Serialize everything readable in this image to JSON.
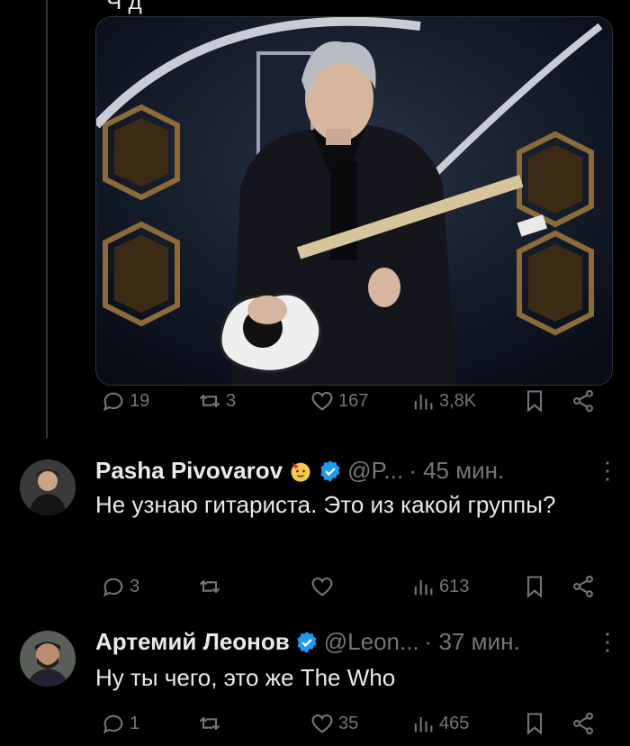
{
  "top_text": "Ч д",
  "post": {
    "replies": "19",
    "reposts": "3",
    "likes": "167",
    "views": "3,8K"
  },
  "replies": [
    {
      "username": "Pasha Pivovarov",
      "handle": "@P...",
      "time": "· 45 мин.",
      "text": "Не узнаю гитариста. Это из какой группы?",
      "stats": {
        "replies": "3",
        "reposts": "",
        "likes": "",
        "views": "613"
      }
    },
    {
      "username": "Артемий Леонов",
      "handle": "@Leon...",
      "time": "· 37 мин.",
      "text": "Ну ты чего, это же The Who",
      "stats": {
        "replies": "1",
        "reposts": "",
        "likes": "35",
        "views": "465"
      }
    }
  ],
  "more_glyph": "⋮",
  "colors": {
    "background": "#000000",
    "text": "#e7e9ea",
    "muted": "#71767b",
    "verified": "#1d9bf0"
  }
}
